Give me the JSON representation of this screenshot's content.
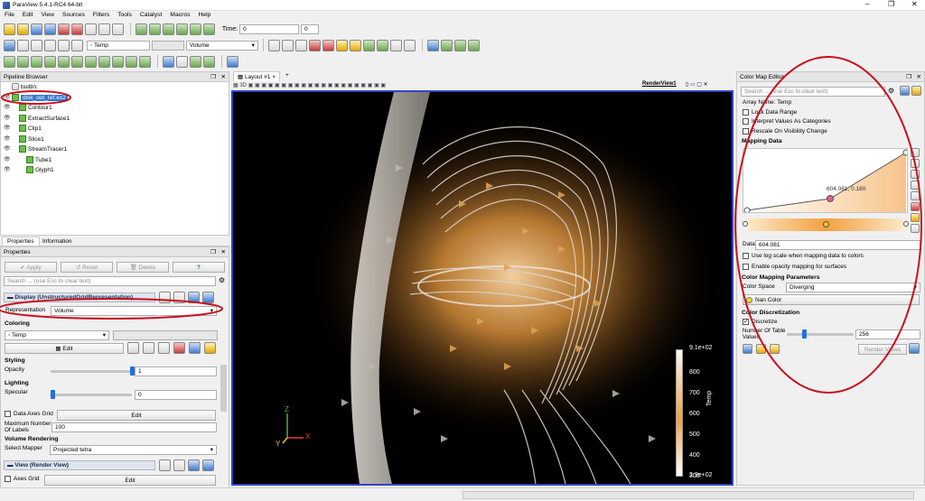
{
  "window": {
    "title": "ParaView 5.4.1-RC4 64-bit"
  },
  "menu": [
    "File",
    "Edit",
    "View",
    "Sources",
    "Filters",
    "Tools",
    "Catalyst",
    "Macros",
    "Help"
  ],
  "toolbar": {
    "time_label": "Time:",
    "time_value": "0",
    "time_index": "0",
    "color_by": "Temp",
    "representation": "Volume"
  },
  "pipeline": {
    "title": "Pipeline Browser",
    "builtin": "builtin:",
    "items": [
      {
        "label": "disk_out_ref.ex2",
        "indent": 1,
        "selected": true
      },
      {
        "label": "Contour1",
        "indent": 2
      },
      {
        "label": "ExtractSurface1",
        "indent": 2
      },
      {
        "label": "Clip1",
        "indent": 2
      },
      {
        "label": "Slice1",
        "indent": 2
      },
      {
        "label": "StreamTracer1",
        "indent": 2
      },
      {
        "label": "Tube1",
        "indent": 3
      },
      {
        "label": "Glyph1",
        "indent": 3
      }
    ]
  },
  "tabs": {
    "properties": "Properties",
    "information": "Information"
  },
  "properties": {
    "title": "Properties",
    "apply": "Apply",
    "reset": "Reset",
    "delete": "Delete",
    "help": "?",
    "search_placeholder": "Search ... (use Esc to clear text)",
    "display_section": "Display (UnstructuredGridRepresentation)",
    "representation_label": "Representation",
    "representation_value": "Volume",
    "coloring_header": "Coloring",
    "coloring_value": "Temp",
    "edit": "Edit",
    "styling_header": "Styling",
    "opacity_label": "Opacity",
    "opacity_value": "1",
    "opacity_level": 1,
    "lighting_header": "Lighting",
    "specular_label": "Specular",
    "specular_value": "0",
    "specular_level": 0,
    "data_axes_grid": "Data Axes Grid",
    "max_labels_label": "Maximum Number Of Labels",
    "max_labels_value": "100",
    "volume_rendering_header": "Volume Rendering",
    "select_mapper_label": "Select Mapper",
    "select_mapper_value": "Projected tetra",
    "view_section": "View (Render View)",
    "axes_grid": "Axes Grid"
  },
  "layout": {
    "tab": "Layout #1",
    "close": "×",
    "add": "+",
    "view_name": "RenderView1",
    "three_d": "3D"
  },
  "colorbar": {
    "title": "Temp",
    "max": "9.1e+02",
    "min": "2.9e+02",
    "ticks": [
      "800",
      "700",
      "600",
      "500",
      "400",
      "300"
    ],
    "colors": {
      "top": "#fdf8f0",
      "mid": "#f2a041",
      "bottom": "#ffffff"
    }
  },
  "axes": {
    "x": "X",
    "y": "Y",
    "z": "Z"
  },
  "colormap": {
    "title": "Color Map Editor",
    "search_placeholder": "Search ... (use Esc to clear text)",
    "array_name": "Array Name: Temp",
    "lock_range": "Lock Data Range",
    "interpret": "Interpret Values As Categories",
    "rescale": "Rescale On Visibility Change",
    "mapping_header": "Mapping Data",
    "point_label": "604.081, 0.180",
    "data_label": "Data",
    "data_value": "604.081",
    "log_scale": "Use log scale when mapping data to colors",
    "opacity_mapping": "Enable opacity mapping for surfaces",
    "params_header": "Color Mapping Parameters",
    "color_space_label": "Color Space",
    "color_space_value": "Diverging",
    "nan_color": "Nan Color",
    "discretization_header": "Color Discretization",
    "discretize": "Discretize",
    "table_values_label": "Number Of Table Values",
    "table_values_value": "256",
    "render_views": "Render Views"
  },
  "highlights": {
    "color": "#c8101e"
  }
}
